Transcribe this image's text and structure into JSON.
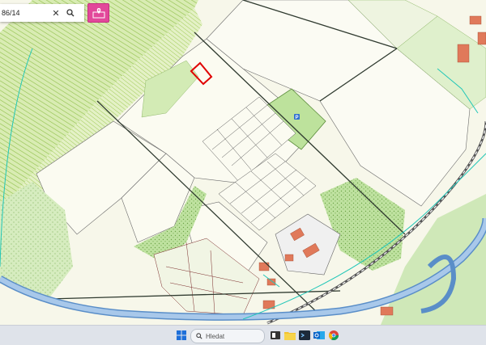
{
  "search": {
    "value": "86/14",
    "clear_icon": "close-icon",
    "search_icon": "search-icon"
  },
  "cadastre_button": {
    "icon": "map-marker-icon",
    "color": "#e2489a"
  },
  "map": {
    "highlight_color": "#e00000",
    "parcel_green": "#cfe7a5",
    "forest_green": "#a9d68c",
    "river_blue": "#7fa8d8",
    "railway_color": "#555555",
    "road_color": "#2f3a2f",
    "building_color": "#e0795a",
    "boundary_cyan": "#22c7b8",
    "poi_badge": "P"
  },
  "taskbar": {
    "search_placeholder": "Hledat",
    "icons": [
      "windows-start-icon",
      "search-icon",
      "widgets-icon",
      "file-explorer-icon",
      "terminal-icon",
      "outlook-icon",
      "chrome-icon"
    ]
  }
}
